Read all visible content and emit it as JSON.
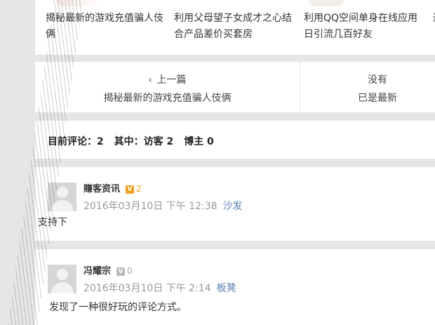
{
  "related": {
    "items": [
      "揭秘最新的游戏充值骗人伎俩",
      "利用父母望子女成才之心结合产品差价买套房",
      "利用QQ空间单身在线应用日引流几百好友",
      "通"
    ]
  },
  "nav": {
    "prev_label": "上一篇",
    "prev_title": "揭秘最新的游戏充值骗人伎俩",
    "next_label": "没有",
    "next_title": "已是最新"
  },
  "stats": {
    "comments": "目前评论：2",
    "guests": "其中：访客  2",
    "bloggers": "博主  0"
  },
  "comments": [
    {
      "author": "赚客资讯",
      "badge": "V",
      "level": "2",
      "badge_color": "#f0a020",
      "date": "2016年03月10日 下午 12:38",
      "location": "沙发",
      "text": "支持下"
    },
    {
      "author": "冯耀宗",
      "badge": "V",
      "level": "0",
      "badge_color": "#b8b8b8",
      "date": "2016年03月10日 下午 2:14",
      "location": "板凳",
      "text": "发现了一种很好玩的评论方式。"
    }
  ]
}
